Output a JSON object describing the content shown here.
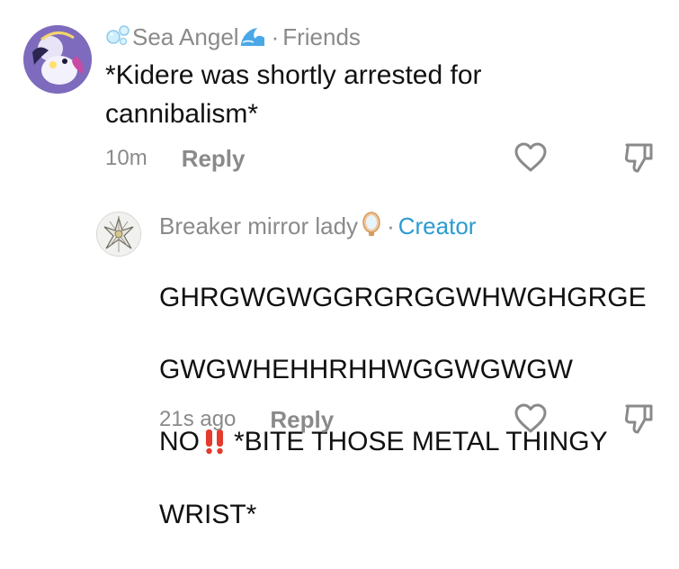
{
  "comments": [
    {
      "username": "Sea Angel",
      "relation": "Friends",
      "body": "*Kidere was shortly arrested for\ncannibalism*",
      "time": "10m",
      "reply_label": "Reply"
    },
    {
      "username": "Breaker mirror lady",
      "relation": "Creator",
      "body_lines": [
        "GHRGWGWGGRGRGGWHWGHGRGE",
        "GWGWHEHHRHHWGGWGWGW",
        "NO",
        "*BITE THOSE METAL THINGY",
        "WRIST*"
      ],
      "time": "21s ago",
      "reply_label": "Reply"
    }
  ],
  "colors": {
    "meta_gray": "#8a8a8a",
    "creator_blue": "#2a9bd1",
    "body_black": "#111111"
  },
  "icons": {
    "like": "heart-outline-icon",
    "dislike": "thumbs-down-outline-icon",
    "bubble": "bubbles-emoji-icon",
    "wave": "wave-emoji-icon",
    "mirror": "mirror-emoji-icon",
    "exclamation": "double-exclamation-emoji-icon"
  }
}
